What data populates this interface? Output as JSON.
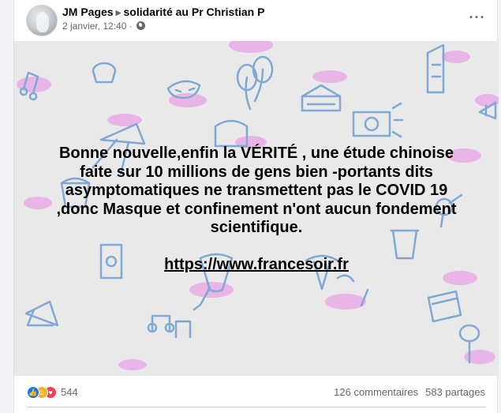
{
  "post": {
    "author": "JM Pages",
    "group": "solidarité au Pr Christian P",
    "timestamp": "2 janvier, 12:40",
    "more_icon_label": "···",
    "audience_icon": "globe-icon"
  },
  "image": {
    "lines": [
      "Bonne nouvelle,enfin la VÉRITÉ , une étude chinoise",
      "faite sur 10 millions de gens bien -portants dits",
      "asymptomatiques ne transmettent pas le COVID 19",
      ",donc Masque et confinement n'ont aucun fondement",
      "scientifique."
    ],
    "link": "https://www.francesoir.fr",
    "background_color": "#e9e9ea",
    "doodle_stroke": "#7fa8d4",
    "doodle_accent": "#e8a3e6"
  },
  "footer": {
    "reactions": [
      "like-icon",
      "care-icon",
      "love-icon"
    ],
    "reaction_count": "544",
    "comments": "126 commentaires",
    "shares": "583 partages"
  },
  "colors": {
    "like": "#1877f2",
    "care": "#f7b125",
    "love": "#f33e58",
    "secondary_text": "#65676b"
  }
}
